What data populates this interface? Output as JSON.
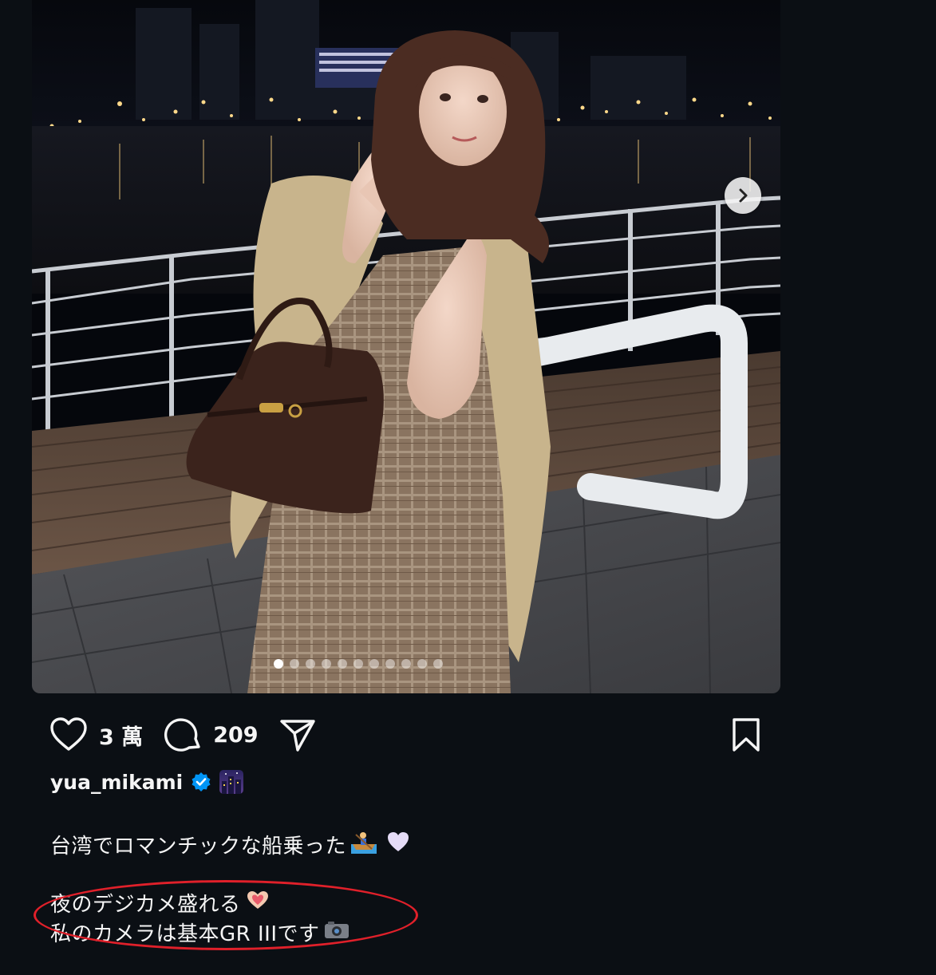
{
  "post": {
    "image_carousel": {
      "total_slides": 11,
      "active_slide": 1
    },
    "actions": {
      "like_count": "3 萬",
      "comment_count": "209"
    },
    "author": {
      "username": "yua_mikami"
    },
    "caption": {
      "line1": "台湾でロマンチックな船乗った",
      "line2": "夜のデジカメ盛れる",
      "line3": "私のカメラは基本GR IIIです"
    }
  },
  "colors": {
    "background": "#0b0f14",
    "text": "#f5f5f5",
    "verified": "#0095f6",
    "highlight": "#e0202a"
  },
  "icons": [
    "heart-icon",
    "comment-icon",
    "share-icon",
    "bookmark-icon",
    "verified-badge-icon",
    "chevron-right-icon",
    "rowboat-emoji",
    "heart-emoji",
    "hand-heart-emoji",
    "camera-emoji",
    "night-city-emoji"
  ]
}
